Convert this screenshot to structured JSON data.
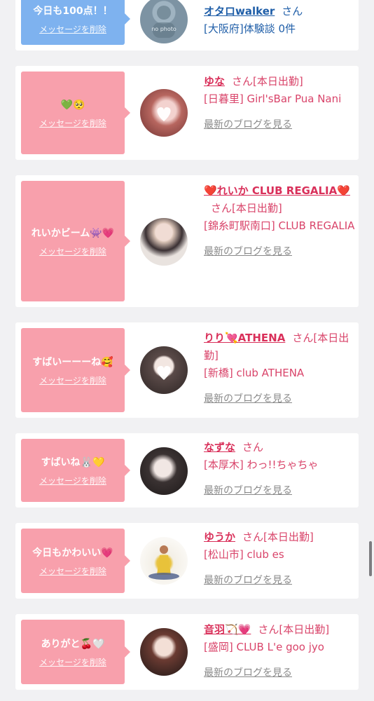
{
  "delete_label": "メッセージを削除",
  "san": "さん",
  "blog_label": "最新のブログを見る",
  "colors": {
    "pink_bubble": "#f8a0ac",
    "blue_bubble": "#7eb2ef",
    "name_pink": "#d9305a",
    "name_blue": "#1f5ea8"
  },
  "cards": [
    {
      "message": "今日も100点！！",
      "name": "オタロwalker",
      "suffix": "",
      "shop": "[大阪府]体験談 0件",
      "avatar_text": "no photo"
    },
    {
      "message": "💚🥺",
      "name": "ゆな",
      "suffix": "[本日出勤]",
      "shop": "[日暮里] Girl'sBar Pua Nani"
    },
    {
      "message": "れいかビーム👾💗",
      "name": "❤️れいか CLUB REGALIA❤️",
      "suffix": "[本日出勤]",
      "shop": "[錦糸町駅南口] CLUB REGALIA"
    },
    {
      "message": "すばいーーーね🥰",
      "name": "りり💘ATHENA",
      "suffix": "[本日出勤]",
      "shop": "[新橋] club ATHENA"
    },
    {
      "message": "すばいね🐰💛",
      "name": "なずな",
      "suffix": "",
      "shop": "[本厚木] わっ!!ちゃちゃ"
    },
    {
      "message": "今日もかわいい💗",
      "name": "ゆうか",
      "suffix": "[本日出勤]",
      "shop": "[松山市] club es"
    },
    {
      "message": "ありがと🍒🤍",
      "name": "音羽🏹💗",
      "suffix": "[本日出勤]",
      "shop": "[盛岡] CLUB L'e goo jyo"
    }
  ]
}
